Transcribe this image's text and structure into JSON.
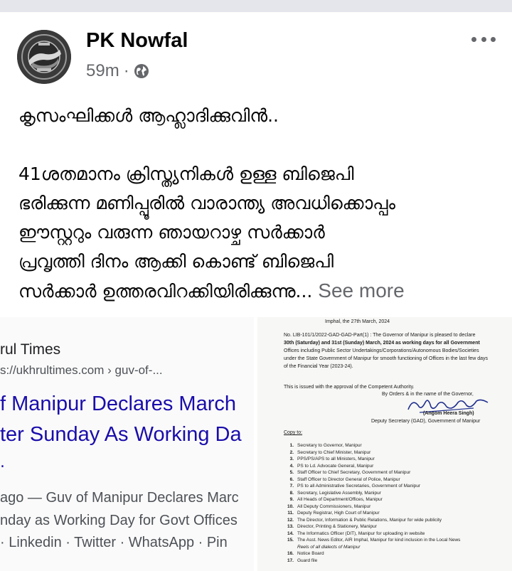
{
  "post": {
    "author": "PK Nowfal",
    "time": "59m",
    "separator": "·",
    "text_lines": [
      "കൃസംഘിക്കൾ ആഹ്ലാദിക്കുവിൻ..",
      "",
      "41ശതമാനം ക്രിസ്ത്യനികൾ ഉള്ള ബിജെപി",
      "ഭരിക്കുന്ന മണിപ്പൂരിൽ വാരാന്ത്യ അവധിക്കൊപ്പം",
      "ഈസ്റ്ററും വരുന്ന ഞായറാഴ്ച സർക്കാർ",
      "പ്രവൃത്തി ദിനം ആക്കി കൊണ്ട് ബിജെപി",
      "സർക്കാർ ഉത്തരവിറക്കിയിരിക്കുന്നു..."
    ],
    "see_more": "See more"
  },
  "icons": {
    "globe": "globe-icon",
    "more": "more-options-icon"
  },
  "search_result": {
    "site": "rul Times",
    "url": "s://ukhrultimes.com › guv-of-...",
    "title_line1": "f Manipur Declares March",
    "title_line2": "ter Sunday As Working Da",
    "title_line3": ".",
    "snippet_line1": "ago — Guv of Manipur Declares Marc",
    "snippet_line2": "nday as Working Day for Govt Offices",
    "snippet_line3": "· Linkedin · Twitter · WhatsApp · Pin"
  },
  "document": {
    "date_line": "Imphal, the 27th March, 2024",
    "body_lines": [
      "No. LIB-101/1/2022-GAD-GAD-Part(1) : The Governor of Manipur is pleased to declare",
      "30th (Saturday) and 31st (Sunday) March, 2024 as working days for all Government",
      "Offices including Public Sector Undertakings/Corporations/Autonomous Bodies/Societies",
      "under the State Government of Manipur for smooth functioning of Offices in the last few days",
      "of the Financial Year (2023-24)."
    ],
    "approval": "This is issued with the approval of the Competent Authority.",
    "by_orders": "By Orders & in the name of the Governor,",
    "signatory_name": "(Angom Heera Singh)",
    "signatory_title": "Deputy Secretary (GAD), Government of Manipur",
    "copy_to": "Copy to:",
    "copy_list": [
      {
        "num": "1.",
        "text": "Secretary to Governor, Manipur"
      },
      {
        "num": "2.",
        "text": "Secretary to Chief Minister, Manipur"
      },
      {
        "num": "3.",
        "text": "PPS/PS/APS to all Ministers, Manipur"
      },
      {
        "num": "4.",
        "text": "PS to Ld. Advocate General, Manipur"
      },
      {
        "num": "5.",
        "text": "Staff Officer to Chief Secretary, Government of Manipur"
      },
      {
        "num": "6.",
        "text": "Staff Officer to Director General of Police, Manipur"
      },
      {
        "num": "7.",
        "text": "PS to all Administrative Secretaries, Government of Manipur"
      },
      {
        "num": "8.",
        "text": "Secretary, Legislative Assembly, Manipur"
      },
      {
        "num": "9.",
        "text": "All Heads of Department/Offices, Manipur"
      },
      {
        "num": "10.",
        "text": "All Deputy Commissioners, Manipur"
      },
      {
        "num": "11.",
        "text": "Deputy Registrar, High Court of Manipur"
      },
      {
        "num": "12.",
        "text": "The Director, Information & Public Relations, Manipur for wide publicity"
      },
      {
        "num": "13.",
        "text": "Director, Printing & Stationery, Manipur"
      },
      {
        "num": "14.",
        "text": "The Informatics Officer (DIT), Manipur for uploading in website"
      },
      {
        "num": "15.",
        "text": "The Asst. News Editor, AIR Imphal, Manipur for kind inclusion in the Local News"
      },
      {
        "num": "",
        "text": "Reels of all dialects of Manipur"
      },
      {
        "num": "16.",
        "text": "Notice Board"
      },
      {
        "num": "17.",
        "text": "Guard file"
      }
    ]
  },
  "colors": {
    "author": "#050505",
    "meta": "#65676b",
    "link_blue": "#1a0dab",
    "top_bar": "#e4e6eb"
  }
}
